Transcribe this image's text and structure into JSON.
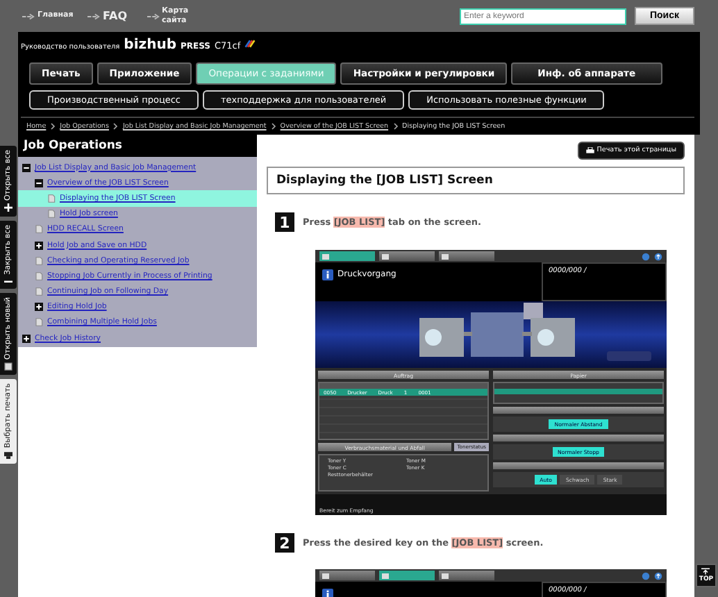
{
  "top_links": [
    {
      "label": "Главная"
    },
    {
      "label": "FAQ"
    },
    {
      "label": "Карта сайта"
    }
  ],
  "search": {
    "placeholder": "Enter a keyword",
    "button": "Поиск"
  },
  "header": {
    "title_prefix": "Руководство пользователя",
    "product": "bizhub",
    "product_suffix": "PRESS",
    "model": "C71cf"
  },
  "main_tabs": [
    {
      "label": "Печать",
      "selected": false
    },
    {
      "label": "Приложение",
      "selected": false
    },
    {
      "label": "Операции с заданиями",
      "selected": true
    },
    {
      "label": "Настройки и регулировки",
      "selected": false
    },
    {
      "label": "Инф. об аппарате",
      "selected": false
    }
  ],
  "sub_tabs": [
    {
      "label": "Производственный процесс"
    },
    {
      "label": "техподдержка для пользователей"
    },
    {
      "label": "Использовать полезные функции"
    }
  ],
  "breadcrumb": [
    "Home",
    "Job Operations",
    "Job List Display and Basic Job Management",
    "Overview of the JOB LIST Screen",
    "Displaying the JOB LIST Screen"
  ],
  "side_tabs": [
    {
      "label": "Открыть все",
      "selected": false
    },
    {
      "label": "Закрыть все",
      "selected": false
    },
    {
      "label": "Открыть новый",
      "selected": false
    },
    {
      "label": "Выбрать печать",
      "selected": true
    }
  ],
  "sidebar": {
    "title": "Job Operations",
    "tree": [
      {
        "label": "Job List Display and Basic Job Management",
        "kind": "folder",
        "expanded": true,
        "selected": false,
        "children": [
          {
            "label": "Overview of the JOB LIST Screen",
            "kind": "folder",
            "expanded": true,
            "selected": false,
            "children": [
              {
                "label": "Displaying the JOB LIST Screen",
                "kind": "page",
                "selected": true
              },
              {
                "label": "Hold Job screen",
                "kind": "page",
                "selected": false
              }
            ]
          },
          {
            "label": "HDD RECALL Screen",
            "kind": "page",
            "selected": false
          },
          {
            "label": "Hold Job and Save on HDD",
            "kind": "folder",
            "expanded": false,
            "selected": false
          },
          {
            "label": "Checking and Operating Reserved Job",
            "kind": "page",
            "selected": false
          },
          {
            "label": "Stopping Job Currently in Process of Printing",
            "kind": "page",
            "selected": false
          },
          {
            "label": "Continuing Job on Following Day",
            "kind": "page",
            "selected": false
          },
          {
            "label": "Editing Hold Job",
            "kind": "folder",
            "expanded": false,
            "selected": false
          },
          {
            "label": "Combining Multiple Hold Jobs",
            "kind": "page",
            "selected": false
          }
        ]
      },
      {
        "label": "Check Job History",
        "kind": "folder",
        "expanded": false,
        "selected": false
      }
    ]
  },
  "content": {
    "print_button": "Печать этой страницы",
    "heading": "Displaying the [JOB LIST] Screen",
    "steps": [
      {
        "number": "1",
        "before": "Press ",
        "key": "[JOB LIST]",
        "after": " tab on the screen.",
        "panel": {
          "tabs": [
            {
              "selected": true
            },
            {
              "selected": false
            },
            {
              "selected": false
            }
          ],
          "title": "Druckvorgang",
          "counter": "0000/000 /",
          "job_section": "Auftrag",
          "job_row": [
            "0050",
            "Drucker",
            "Druck",
            "1",
            "0001"
          ],
          "supplies_section": "Verbrauchsmaterial und Abfall",
          "toner_button": "Tonerstatus",
          "toners": [
            "Toner Y",
            "Toner M",
            "Toner C",
            "Toner K",
            "Resttonerbehälter"
          ],
          "paper_section": "Papier",
          "option_groups": [
            [
              {
                "label": "Normaler Abstand",
                "selected": true
              }
            ],
            [
              {
                "label": "Normaler Stopp",
                "selected": true
              }
            ],
            [
              {
                "label": "Auto",
                "selected": true
              },
              {
                "label": "Schwach",
                "selected": false
              },
              {
                "label": "Stark",
                "selected": false
              }
            ]
          ],
          "status": "Bereit zum Empfang"
        }
      },
      {
        "number": "2",
        "before": "Press the desired key on the ",
        "key": "[JOB LIST]",
        "after": " screen.",
        "panel": {
          "tabs": [
            {
              "selected": false
            },
            {
              "selected": true
            },
            {
              "selected": false
            }
          ],
          "counter": "0000/000 /"
        }
      }
    ]
  },
  "top_button": "TOP"
}
